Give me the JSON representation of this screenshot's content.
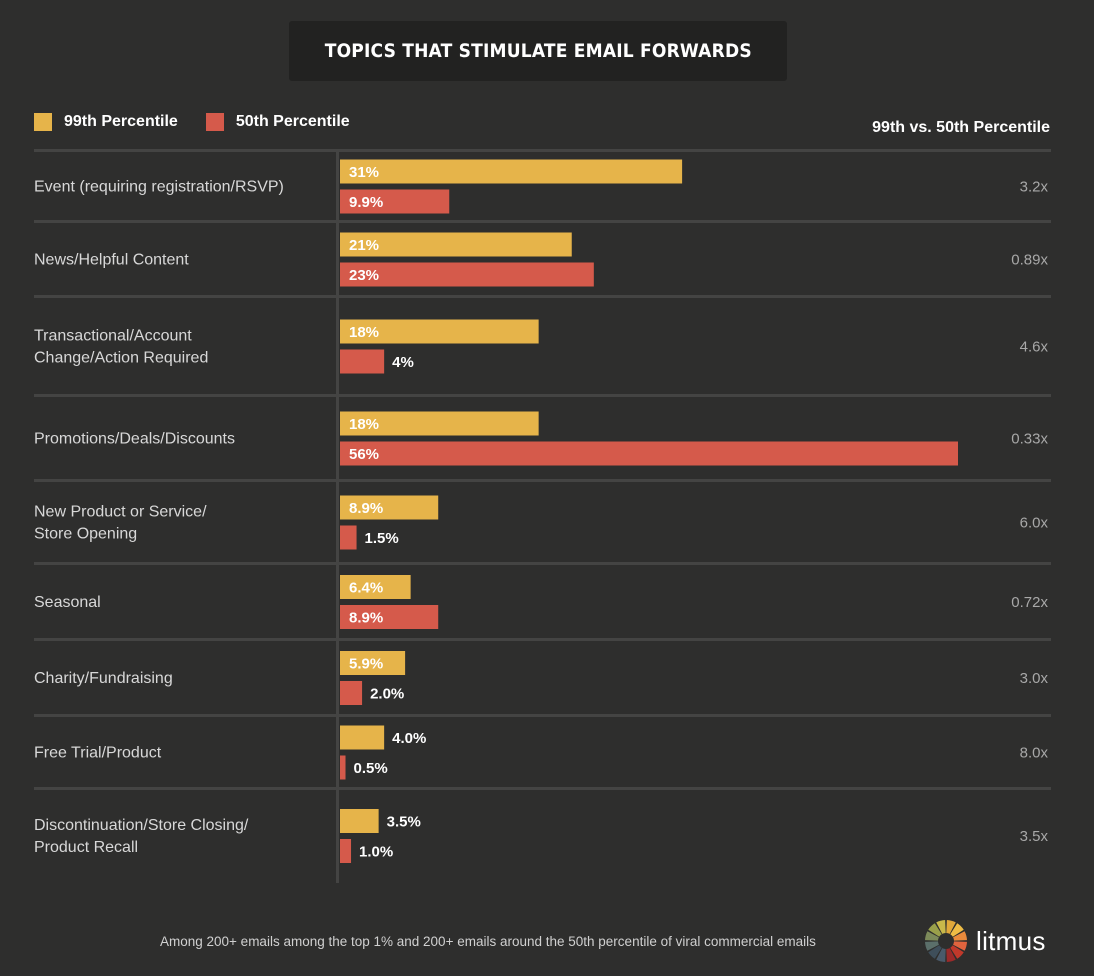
{
  "title": "TOPICS THAT STIMULATE EMAIL FORWARDS",
  "ratio_header": "99th vs. 50th Percentile",
  "footer_note": "Among 200+ emails among the top 1% and 200+ emails around the 50th percentile of viral commercial emails",
  "brand": {
    "name": "litmus",
    "logo_icon": "litmus-color-wheel-icon"
  },
  "colors": {
    "background": "#2e2e2d",
    "p99": "#e6b44a",
    "p50": "#d55a4b",
    "divider": "#444443"
  },
  "chart_data": {
    "type": "bar",
    "orientation": "horizontal",
    "title": "TOPICS THAT STIMULATE EMAIL FORWARDS",
    "xlabel": "",
    "ylabel": "",
    "unit": "%",
    "grid": false,
    "legend_position": "top-left",
    "xlim": [
      0,
      56
    ],
    "categories": [
      "Event (requiring registration/RSVP)",
      "News/Helpful Content",
      "Transactional/Account Change/Action Required",
      "Promotions/Deals/Discounts",
      "New Product or Service/ Store Opening",
      "Seasonal",
      "Charity/Fundraising",
      "Free Trial/Product",
      "Discontinuation/Store Closing/ Product Recall"
    ],
    "category_lines": [
      [
        "Event (requiring registration/RSVP)"
      ],
      [
        "News/Helpful Content"
      ],
      [
        "Transactional/Account",
        "Change/Action Required"
      ],
      [
        "Promotions/Deals/Discounts"
      ],
      [
        "New Product or Service/",
        "Store Opening"
      ],
      [
        "Seasonal"
      ],
      [
        "Charity/Fundraising"
      ],
      [
        "Free Trial/Product"
      ],
      [
        "Discontinuation/Store Closing/",
        "Product Recall"
      ]
    ],
    "series": [
      {
        "name": "99th Percentile",
        "color": "#e6b44a",
        "values": [
          31,
          21,
          18,
          18,
          8.9,
          6.4,
          5.9,
          4.0,
          3.5
        ],
        "labels": [
          "31%",
          "21%",
          "18%",
          "18%",
          "8.9%",
          "6.4%",
          "5.9%",
          "4.0%",
          "3.5%"
        ]
      },
      {
        "name": "50th Percentile",
        "color": "#d55a4b",
        "values": [
          9.9,
          23,
          4,
          56,
          1.5,
          8.9,
          2.0,
          0.5,
          1.0
        ],
        "labels": [
          "9.9%",
          "23%",
          "4%",
          "56%",
          "1.5%",
          "8.9%",
          "2.0%",
          "0.5%",
          "1.0%"
        ]
      }
    ],
    "ratios": [
      "3.2x",
      "0.89x",
      "4.6x",
      "0.33x",
      "6.0x",
      "0.72x",
      "3.0x",
      "8.0x",
      "3.5x"
    ]
  }
}
